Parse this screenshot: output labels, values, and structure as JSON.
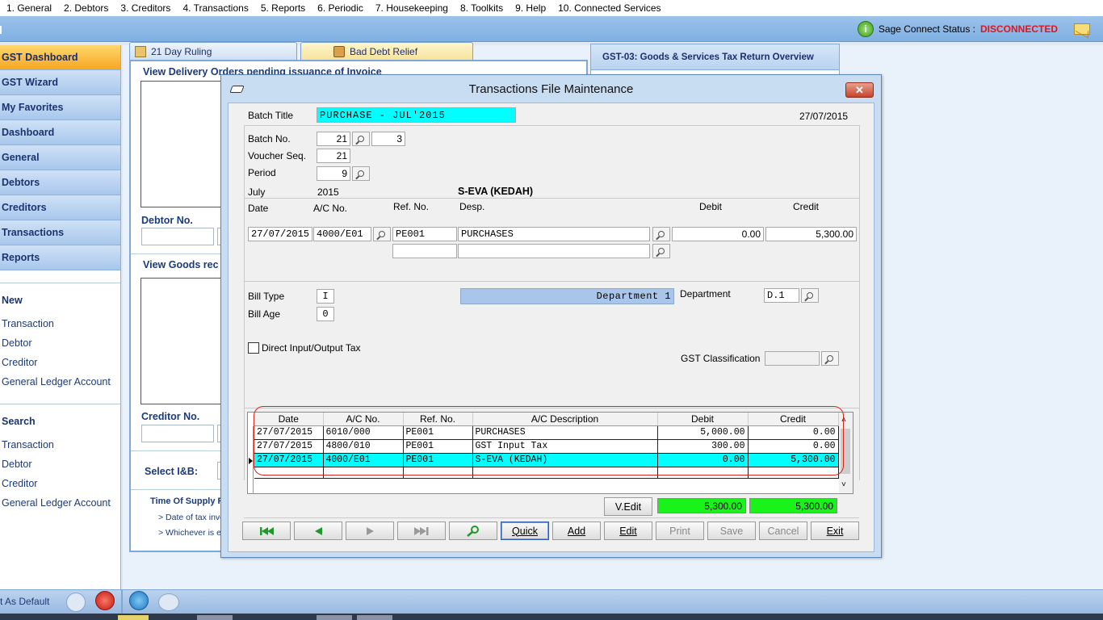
{
  "menubar": [
    "1. General",
    "2. Debtors",
    "3. Creditors",
    "4. Transactions",
    "5. Reports",
    "6. Periodic",
    "7. Housekeeping",
    "8. Toolkits",
    "9. Help",
    "10. Connected Services"
  ],
  "status": {
    "label": "Sage Connect Status :",
    "value": "DISCONNECTED",
    "value_color": "#e0141a"
  },
  "leftnav": {
    "buttons": [
      "GST Dashboard",
      "GST Wizard",
      "My Favorites",
      "Dashboard",
      "General",
      "Debtors",
      "Creditors",
      "Transactions",
      "Reports"
    ],
    "new_heading": "New",
    "new_items": [
      "Transaction",
      "Debtor",
      "Creditor",
      "General Ledger Account"
    ],
    "search_heading": "Search",
    "search_items": [
      "Transaction",
      "Debtor",
      "Creditor",
      "General Ledger Account"
    ],
    "bottom_text": "t As Default"
  },
  "dashboard": {
    "tabs": [
      "21 Day Ruling",
      "Bad Debt Relief"
    ],
    "right_panel_title": "GST-03: Goods & Services Tax Return Overview",
    "view_do": "View Delivery Orders pending issuance of Invoice",
    "debtor_no": "Debtor No.",
    "view_goods": "View Goods rec",
    "creditor_no": "Creditor No.",
    "select_ib": "Select I&B:",
    "time_supply": "Time Of Supply R",
    "bullet1": "> Date of tax invo",
    "bullet2": "> Whichever is e"
  },
  "dialog": {
    "title": "Transactions File Maintenance",
    "batch_title_label": "Batch Title",
    "batch_title": "PURCHASE - JUL'2015",
    "date": "27/07/2015",
    "batch_no_label": "Batch No.",
    "batch_no": "21",
    "batch_no2": "3",
    "voucher_seq_label": "Voucher Seq.",
    "voucher_seq": "21",
    "period_label": "Period",
    "period": "9",
    "month": "July",
    "year": "2015",
    "account_name": "S-EVA (KEDAH)",
    "entry_headers": {
      "date": "Date",
      "ac": "A/C No.",
      "ref": "Ref. No.",
      "desp": "Desp.",
      "debit": "Debit",
      "credit": "Credit"
    },
    "entry": {
      "date": "27/07/2015",
      "ac": "4000/E01",
      "ref": "PE001",
      "desp": "PURCHASES",
      "debit": "0.00",
      "credit": "5,300.00"
    },
    "bill_type_label": "Bill Type",
    "bill_type": "I",
    "bill_age_label": "Bill Age",
    "bill_age": "0",
    "department_name": "Department 1",
    "department_label": "Department",
    "department": "D.1",
    "direct_tax_label": "Direct Input/Output Tax",
    "gst_class_label": "GST Classification",
    "grid": {
      "headers": [
        "Date",
        "A/C No.",
        "Ref. No.",
        "A/C Description",
        "Debit",
        "Credit"
      ],
      "rows": [
        [
          "27/07/2015",
          "6010/000",
          "PE001",
          "PURCHASES",
          "5,000.00",
          "0.00"
        ],
        [
          "27/07/2015",
          "4800/010",
          "PE001",
          "GST Input Tax",
          "300.00",
          "0.00"
        ],
        [
          "27/07/2015",
          "4000/E01",
          "PE001",
          "S-EVA (KEDAH)",
          "0.00",
          "5,300.00"
        ]
      ],
      "selected_row": 2
    },
    "vedit_label": "V.Edit",
    "total_debit": "5,300.00",
    "total_credit": "5,300.00",
    "buttons": {
      "quick": "Quick",
      "add": "Add",
      "edit": "Edit",
      "print": "Print",
      "save": "Save",
      "cancel": "Cancel",
      "exit": "Exit"
    }
  },
  "colors": {
    "selection": "#00ffff",
    "totals": "#19f319",
    "nav_active": "#f6a623"
  }
}
